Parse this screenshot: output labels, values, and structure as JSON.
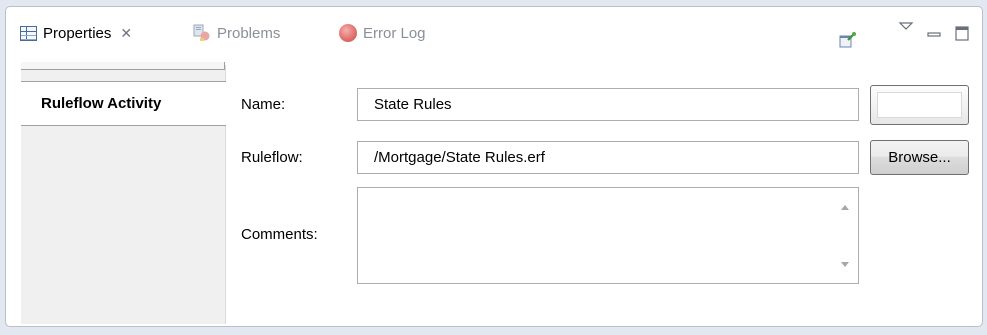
{
  "tabs": [
    {
      "label": "Properties",
      "icon": "properties-icon",
      "active": true,
      "close_glyph": "✕"
    },
    {
      "label": "Problems",
      "icon": "problems-icon",
      "active": false
    },
    {
      "label": "Error Log",
      "icon": "error-log-icon",
      "active": false
    }
  ],
  "toolbar": {
    "icons": [
      "pin-editor-icon",
      "view-menu-icon",
      "minimize-icon",
      "maximize-icon"
    ]
  },
  "sidebar": {
    "selected_tab": "Ruleflow Activity"
  },
  "form": {
    "name_label": "Name:",
    "name_value": "State Rules",
    "ruleflow_label": "Ruleflow:",
    "ruleflow_value": "/Mortgage/State Rules.erf",
    "comments_label": "Comments:",
    "comments_value": "",
    "browse_label": "Browse...",
    "blank_button_label": ""
  },
  "colors": {
    "background": "#e3e7f0",
    "panel": "#ffffff",
    "sidebar": "#f0f0f0",
    "inactive_tab_text": "#8a8f98"
  }
}
